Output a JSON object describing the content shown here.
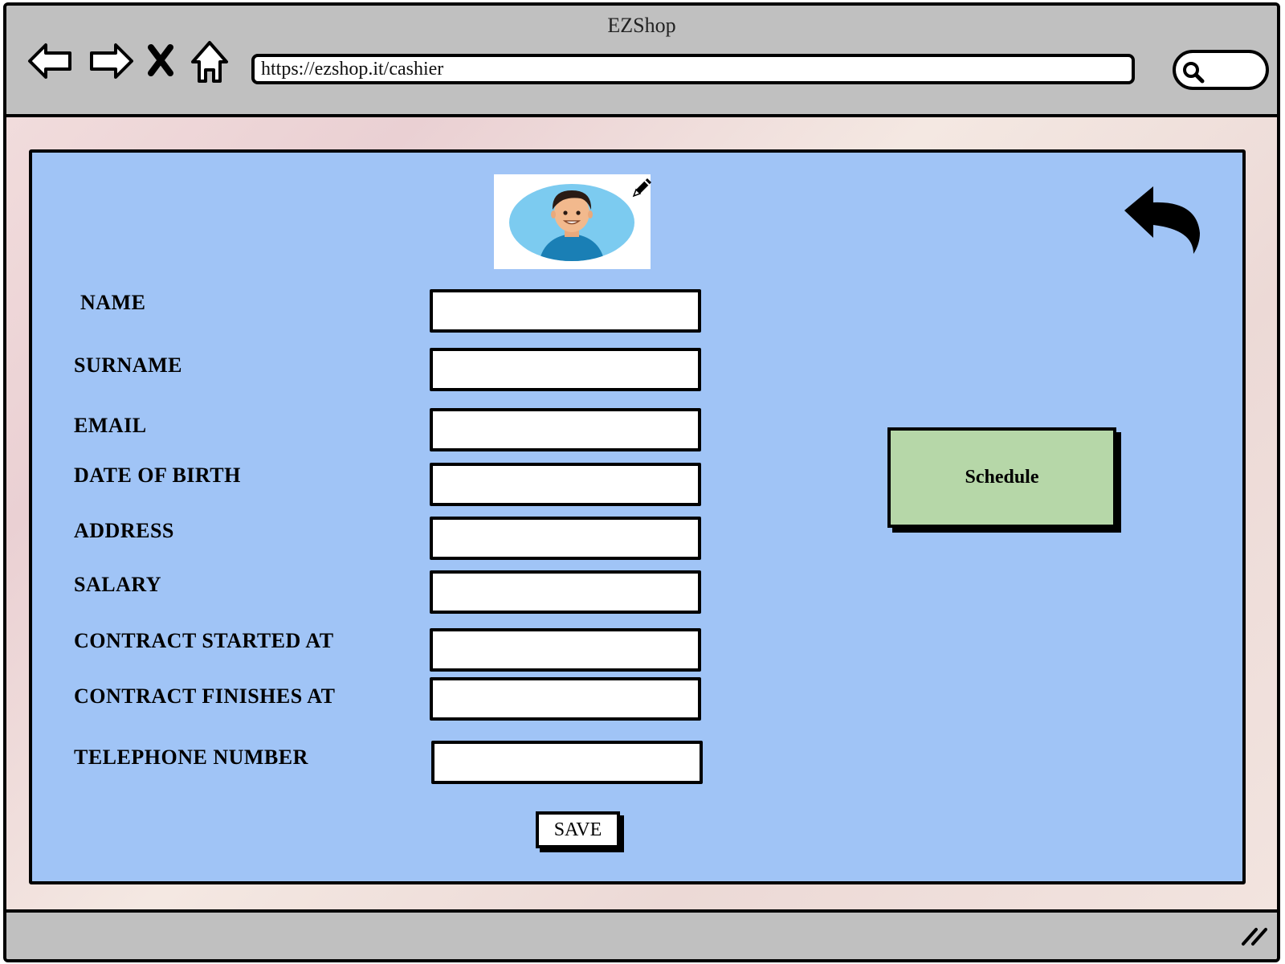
{
  "browser": {
    "title": "EZShop",
    "url": "https://ezshop.it/cashier",
    "icons": [
      "back-arrow-icon",
      "forward-arrow-icon",
      "close-x-icon",
      "home-icon",
      "search-icon"
    ]
  },
  "profile": {
    "avatar": "cashier-avatar",
    "edit_icon": "pencil-icon",
    "back_icon": "curved-back-arrow-icon"
  },
  "form": {
    "fields": [
      {
        "label": "NAME",
        "value": ""
      },
      {
        "label": "SURNAME",
        "value": ""
      },
      {
        "label": "EMAIL",
        "value": ""
      },
      {
        "label": "DATE OF BIRTH",
        "value": ""
      },
      {
        "label": "ADDRESS",
        "value": ""
      },
      {
        "label": "SALARY",
        "value": ""
      },
      {
        "label": "CONTRACT STARTED AT",
        "value": ""
      },
      {
        "label": "CONTRACT FINISHES AT",
        "value": ""
      },
      {
        "label": "TELEPHONE NUMBER",
        "value": ""
      }
    ],
    "save_label": "SAVE"
  },
  "actions": {
    "schedule_label": "Schedule"
  },
  "colors": {
    "panel": "#a0c4f6",
    "schedule_button": "#b6d7a8",
    "chrome": "#c0c0c0"
  }
}
